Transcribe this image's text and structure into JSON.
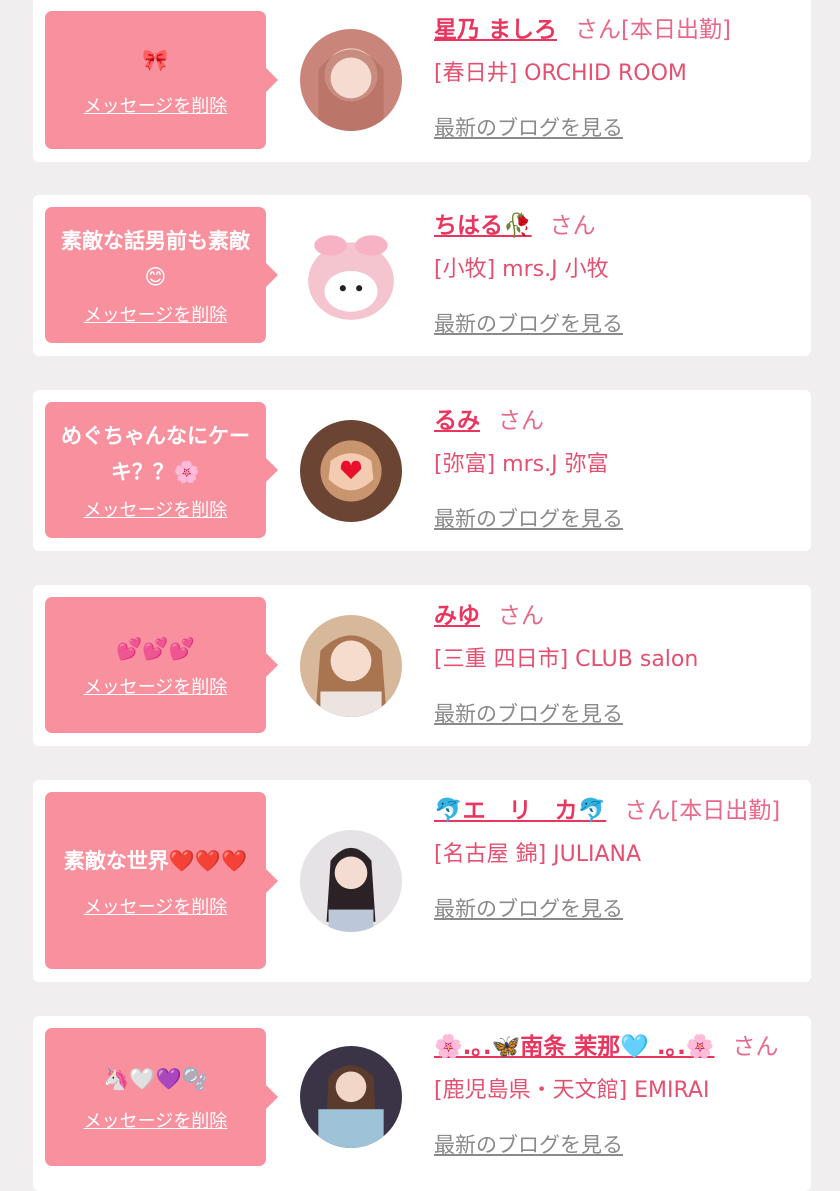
{
  "delete_label": "メッセージを削除",
  "blog_label": "最新のブログを見る",
  "honorific": "さん",
  "items": [
    {
      "message": "🎀",
      "name": "星乃 ましろ",
      "status": "[本日出勤]",
      "shop": "[春日井] ORCHID ROOM",
      "avatar_color": "#c9857a"
    },
    {
      "message": "素敵な話男前も素敵😊",
      "name": "ちはる🥀",
      "status": "",
      "shop": "[小牧] mrs.J 小牧",
      "avatar_color": "#f4c4cf"
    },
    {
      "message": "めぐちゃんなにケーキ？？🌸",
      "name": "るみ",
      "status": "",
      "shop": "[弥富] mrs.J 弥富",
      "avatar_color": "#6b4434"
    },
    {
      "message": "💕💕💕",
      "name": "みゆ",
      "status": "",
      "shop": "[三重 四日市] CLUB salon",
      "avatar_color": "#d8b89a"
    },
    {
      "message": "素敵な世界❤️❤️❤️",
      "name": "🐬エ　リ　カ🐬",
      "status": "[本日出勤]",
      "shop": "[名古屋 錦] JULIANA",
      "avatar_color": "#e6e3e6"
    },
    {
      "message": "🦄🤍💜🫧",
      "name": "🌸.｡.🦋南条 茉那🩵 .｡.🌸",
      "status": "",
      "shop": "[鹿児島県・天文館] EMIRAI",
      "avatar_color": "#9ec3d8"
    }
  ]
}
